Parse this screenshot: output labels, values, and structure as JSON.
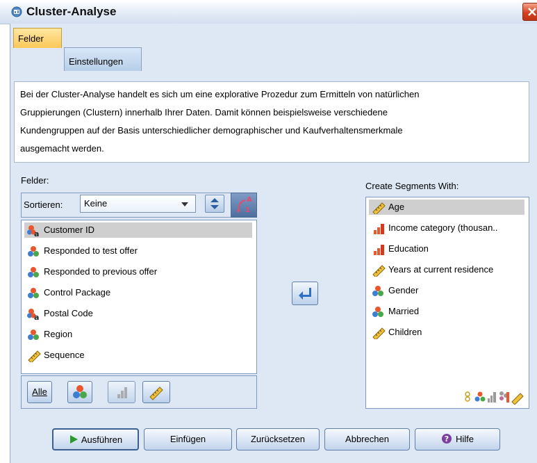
{
  "window": {
    "title": "Cluster-Analyse"
  },
  "tabs": [
    {
      "label": "Felder",
      "active": true
    },
    {
      "label": "Einstellungen",
      "active": false
    }
  ],
  "description": "Bei der Cluster-Analyse handelt es sich um eine explorative Prozedur zum Ermitteln von natürlichen Gruppierungen (Clustern) innerhalb Ihrer Daten. Damit können beispielsweise verschiedene Kundengruppen auf der Basis unterschiedlicher demographischer und Kaufverhaltensmerkmale ausgemacht werden.",
  "description_lines": [
    "Bei der Cluster-Analyse handelt es sich um eine explorative Prozedur zum Ermitteln von natürlichen",
    "Gruppierungen (Clustern) innerhalb Ihrer Daten. Damit können beispielsweise verschiedene",
    "Kundengruppen auf der Basis unterschiedlicher demographischer und Kaufverhaltensmerkmale",
    "ausgemacht werden."
  ],
  "fields": {
    "label": "Felder:",
    "sort_label": "Sortieren:",
    "sort_value": "Keine",
    "items": [
      {
        "label": "Customer ID",
        "icon": "nominal-string-icon",
        "selected": true
      },
      {
        "label": "Responded to test offer",
        "icon": "nominal-icon",
        "selected": false
      },
      {
        "label": "Responded to previous offer",
        "icon": "nominal-icon",
        "selected": false
      },
      {
        "label": "Control Package",
        "icon": "nominal-icon",
        "selected": false
      },
      {
        "label": "Postal Code",
        "icon": "nominal-string-icon",
        "selected": false
      },
      {
        "label": "Region",
        "icon": "nominal-icon",
        "selected": false
      },
      {
        "label": "Sequence",
        "icon": "scale-icon",
        "selected": false
      }
    ],
    "filter_buttons": [
      {
        "label": "Alle",
        "name": "filter-all-button"
      },
      {
        "icon": "nominal-icon",
        "name": "filter-nominal-button"
      },
      {
        "icon": "ordinal-icon",
        "name": "filter-ordinal-button"
      },
      {
        "icon": "scale-icon",
        "name": "filter-scale-button"
      }
    ]
  },
  "segments": {
    "label": "Create Segments With:",
    "items": [
      {
        "label": "Age",
        "icon": "scale-icon",
        "selected": true
      },
      {
        "label": "Income category (thousan..",
        "icon": "ordinal-icon",
        "selected": false
      },
      {
        "label": "Education",
        "icon": "ordinal-icon",
        "selected": false
      },
      {
        "label": "Years at current residence",
        "icon": "scale-icon",
        "selected": false
      },
      {
        "label": "Gender",
        "icon": "nominal-icon",
        "selected": false
      },
      {
        "label": "Married",
        "icon": "nominal-icon",
        "selected": false
      },
      {
        "label": "Children",
        "icon": "scale-icon",
        "selected": false
      }
    ]
  },
  "buttons": {
    "run": "Ausführen",
    "paste": "Einfügen",
    "reset": "Zurücksetzen",
    "cancel": "Abbrechen",
    "help": "Hilfe"
  },
  "colors": {
    "dialog_bg": "#dde8f4",
    "active_tab": "#fcc85a",
    "selection": "#cfcfcf",
    "accent": "#3b5f92"
  }
}
